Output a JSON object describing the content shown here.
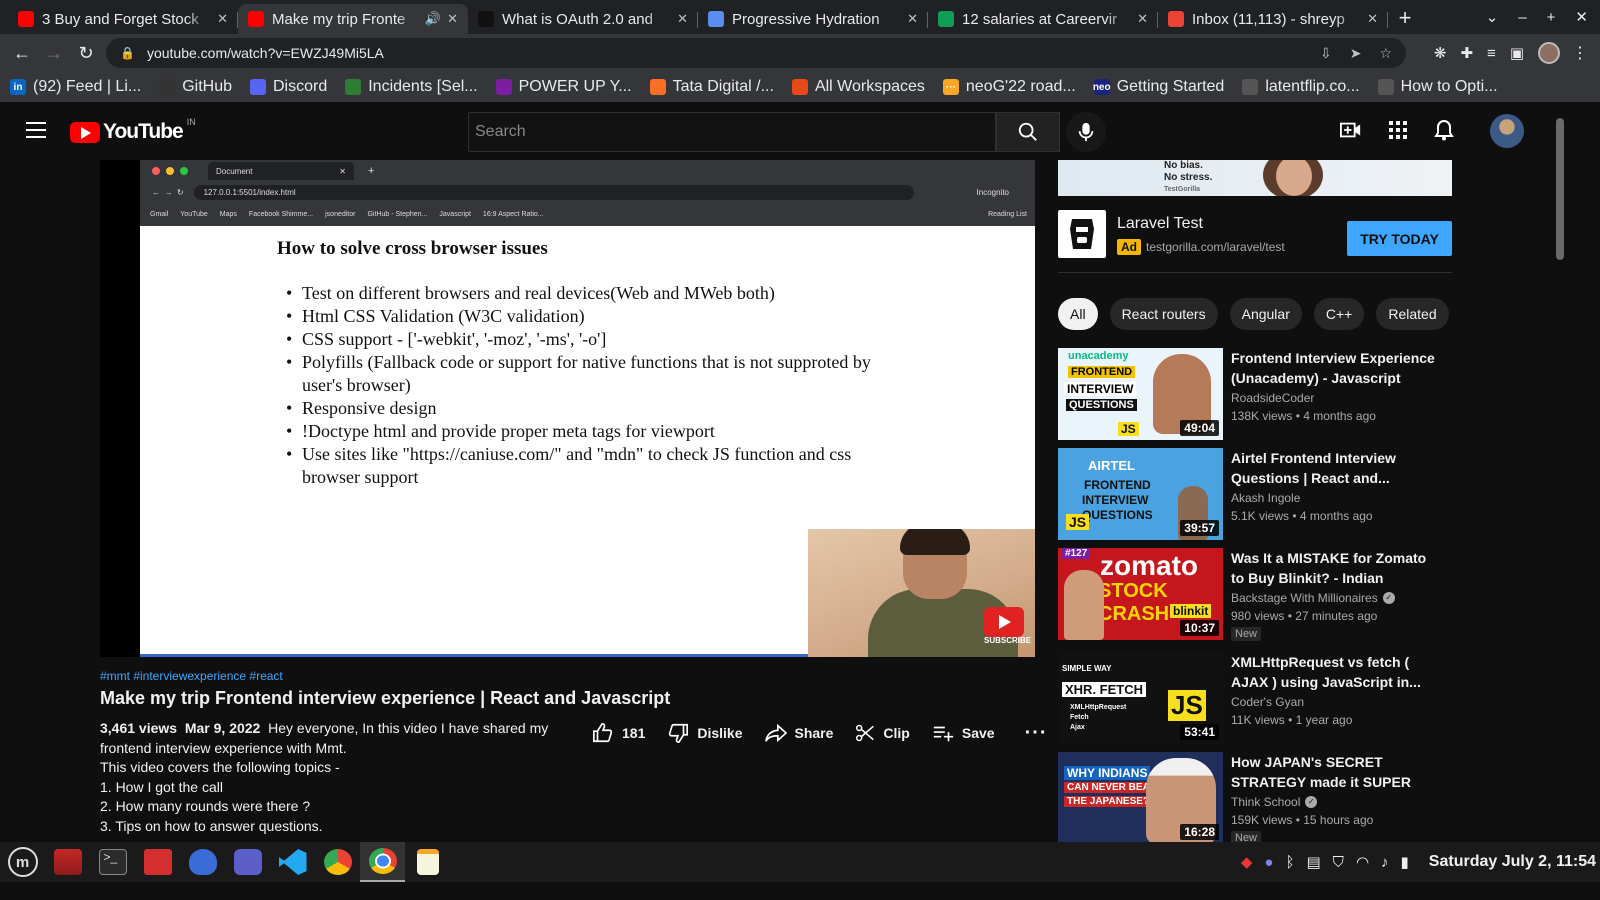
{
  "browser": {
    "tabs": [
      {
        "title": "3 Buy and Forget Stock",
        "icon": "youtube-icon",
        "color": "#ff0000"
      },
      {
        "title": "Make my trip Fronte",
        "icon": "youtube-icon",
        "color": "#ff0000",
        "active": true,
        "audio": true
      },
      {
        "title": "What is OAuth 2.0 and",
        "icon": "github-icon",
        "color": "#111111"
      },
      {
        "title": "Progressive Hydration",
        "icon": "hashnode-icon",
        "color": "#5b8def"
      },
      {
        "title": "12 salaries at Careervir",
        "icon": "sheet-icon",
        "color": "#0f9d58"
      },
      {
        "title": "Inbox (11,113) - shreyp",
        "icon": "gmail-icon",
        "color": "#ea4335"
      }
    ],
    "url": "youtube.com/watch?v=EWZJ49Mi5LA",
    "bookmarks": [
      {
        "label": "(92) Feed | Li...",
        "icon": "linkedin-icon",
        "color": "#0a66c2",
        "glyph": "in"
      },
      {
        "label": "GitHub",
        "icon": "github-icon",
        "color": "#333333",
        "glyph": ""
      },
      {
        "label": "Discord",
        "icon": "discord-icon",
        "color": "#5865f2",
        "glyph": ""
      },
      {
        "label": "Incidents [Sel...",
        "icon": "incident-icon",
        "color": "#2e7d32",
        "glyph": ""
      },
      {
        "label": "POWER UP Y...",
        "icon": "person-icon",
        "color": "#7b1fa2",
        "glyph": ""
      },
      {
        "label": "Tata Digital /...",
        "icon": "gitlab-icon",
        "color": "#fc6d26",
        "glyph": ""
      },
      {
        "label": "All Workspaces",
        "icon": "workspace-icon",
        "color": "#e64a19",
        "glyph": ""
      },
      {
        "label": "neoG'22 road...",
        "icon": "dots-icon",
        "color": "#f9a825",
        "glyph": "···"
      },
      {
        "label": "Getting Started",
        "icon": "neog-icon",
        "color": "#1a237e",
        "glyph": "neo"
      },
      {
        "label": "latentflip.co...",
        "icon": "globe-icon",
        "color": "#555555",
        "glyph": ""
      },
      {
        "label": "How to Opti...",
        "icon": "globe-icon",
        "color": "#555555",
        "glyph": ""
      }
    ]
  },
  "youtube": {
    "logo_text": "YouTube",
    "country": "IN",
    "search_placeholder": "Search"
  },
  "video": {
    "inner_browser": {
      "tab_title": "Document",
      "url": "127.0.0.1:5501/index.html",
      "incognito_label": "Incognito",
      "bookmarks": [
        "Gmail",
        "YouTube",
        "Maps",
        "Facebook Shimme...",
        "jsoneditor",
        "GitHub - Stephen...",
        "Javascript",
        "16:9 Aspect Ratio..."
      ],
      "reading_list": "Reading List"
    },
    "slide_title": "How to solve cross browser issues",
    "slide_points": [
      "Test on different browsers and real devices(Web and MWeb both)",
      "Html CSS Validation (W3C validation)",
      "CSS support - ['-webkit', '-moz', '-ms', '-o']",
      "Polyfills (Fallback code or support for native functions that is not supproted by user's browser)",
      "Responsive design",
      "!Doctype html and provide proper meta tags for viewport",
      "Use sites like \"https://caniuse.com/\" and \"mdn\" to check JS function and css browser support"
    ],
    "subscribe_watermark": "SUBSCRIBE",
    "progress": 0.72,
    "hashtags": "#mmt #interviewexperience #react",
    "title": "Make my trip Frontend interview experience | React and Javascript",
    "views": "3,461 views",
    "date": "Mar 9, 2022",
    "description_lines": [
      "Hey everyone, In this video I have shared my",
      "frontend interview experience with Mmt.",
      "This video covers the following topics -",
      "1. How I got the call",
      "2. How many rounds were there ?",
      "3. Tips on how to answer questions."
    ],
    "likes": "181",
    "dislike_label": "Dislike",
    "share_label": "Share",
    "clip_label": "Clip",
    "save_label": "Save"
  },
  "ad": {
    "banner_lines": [
      "No bias.",
      "No stress."
    ],
    "banner_brand": "TestGorilla",
    "title": "Laravel Test",
    "badge": "Ad",
    "url": "testgorilla.com/laravel/test",
    "cta": "TRY TODAY"
  },
  "chips": [
    "All",
    "React routers",
    "Angular",
    "C++",
    "Related"
  ],
  "recommendations": [
    {
      "title": "Frontend Interview Experience (Unacademy) - Javascript and...",
      "channel": "RoadsideCoder",
      "meta": "138K views • 4 months ago",
      "duration": "49:04",
      "verified": false,
      "new": "",
      "thumb_lines": [
        "unacademy",
        "FRONTEND",
        "INTERVIEW",
        "QUESTIONS",
        "JS"
      ],
      "thumb_color": "#eaf4fb"
    },
    {
      "title": "Airtel Frontend Interview Questions | React and...",
      "channel": "Akash Ingole",
      "meta": "5.1K views • 4 months ago",
      "duration": "39:57",
      "verified": false,
      "new": "",
      "thumb_lines": [
        "AIRTEL",
        "FRONTEND",
        "INTERVIEW",
        "QUESTIONS",
        "JS"
      ],
      "thumb_color": "#4aa3e0"
    },
    {
      "title": "Was It a MISTAKE for Zomato to Buy Blinkit? - Indian Startup...",
      "channel": "Backstage With Millionaires",
      "meta": "980 views • 27 minutes ago",
      "duration": "10:37",
      "verified": true,
      "new": "New",
      "thumb_lines": [
        "#127",
        "zomato",
        "STOCK CRASH",
        "blinkit"
      ],
      "thumb_color": "#c4161c"
    },
    {
      "title": "XMLHttpRequest vs fetch ( AJAX ) using JavaScript in...",
      "channel": "Coder's Gyan",
      "meta": "11K views • 1 year ago",
      "duration": "53:41",
      "verified": false,
      "new": "",
      "thumb_lines": [
        "SIMPLE WAY",
        "XHR. FETCH",
        "JS",
        "XMLHttpRequest",
        "Fetch",
        "Ajax"
      ],
      "thumb_color": "#111111"
    },
    {
      "title": "How JAPAN's SECRET STRATEGY made it SUPER RIC...",
      "channel": "Think School",
      "meta": "159K views • 15 hours ago",
      "duration": "16:28",
      "verified": true,
      "new": "New",
      "thumb_lines": [
        "WHY INDIANS",
        "CAN NEVER BEAT",
        "THE JAPANESE?"
      ],
      "thumb_color": "#1f2e5a"
    }
  ],
  "taskbar": {
    "clock": "Saturday July  2, 11:54"
  }
}
